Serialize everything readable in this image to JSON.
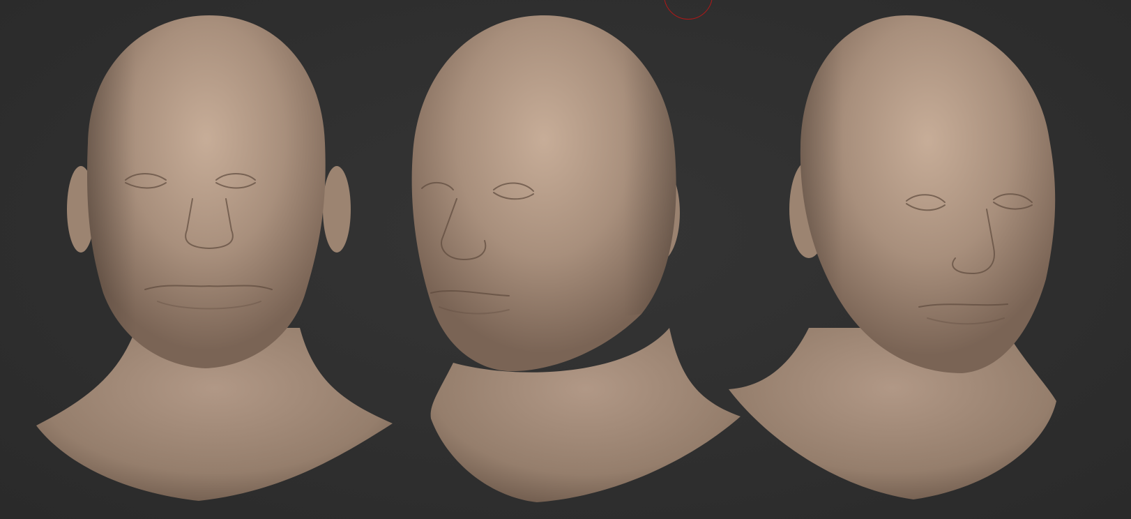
{
  "viewport": {
    "background": "#2e2e2e",
    "material_color": "#a98f7c"
  },
  "models": [
    {
      "view": "front"
    },
    {
      "view": "three-quarter-left"
    },
    {
      "view": "three-quarter-right"
    }
  ],
  "brush_cursor": {
    "color": "#b01818"
  }
}
